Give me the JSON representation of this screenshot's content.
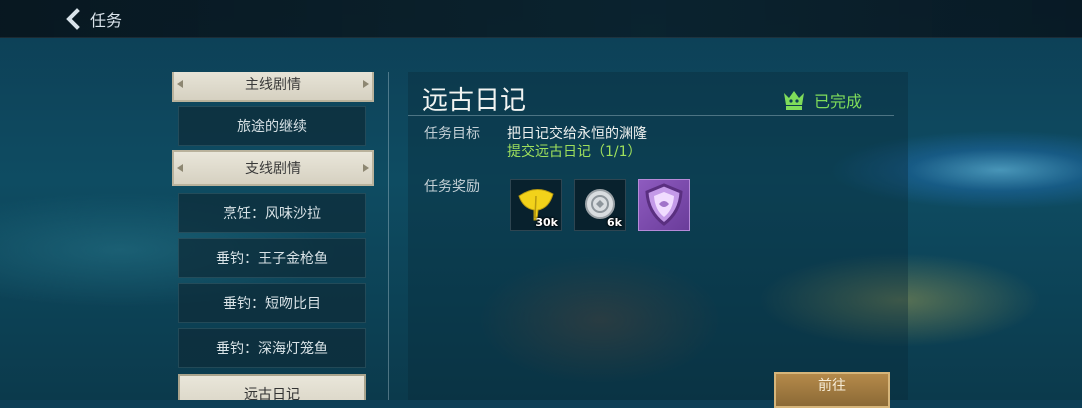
{
  "header": {
    "back_label": "任务"
  },
  "quest_list": {
    "main_category": "主线剧情",
    "main_items": [
      "旅途的继续"
    ],
    "side_category": "支线剧情",
    "side_items": [
      "烹饪：风味沙拉",
      "垂钓：王子金枪鱼",
      "垂钓：短吻比目",
      "垂钓：深海灯笼鱼",
      "远古日记"
    ],
    "selected": "远古日记"
  },
  "detail": {
    "title": "远古日记",
    "status": "已完成",
    "goal_label": "任务目标",
    "goal_text": "把日记交给永恒的渊隆",
    "goal_progress": "提交远古日记（1/1）",
    "reward_label": "任务奖励",
    "rewards": [
      {
        "icon": "gingko-leaf-icon",
        "count": "30k"
      },
      {
        "icon": "silver-coin-icon",
        "count": "6k"
      },
      {
        "icon": "purple-shield-icon",
        "count": ""
      }
    ],
    "go_button": "前往"
  },
  "colors": {
    "status_green": "#7fdc5a",
    "progress_green": "#9fe05c",
    "button_gold": "#b58a4a"
  }
}
